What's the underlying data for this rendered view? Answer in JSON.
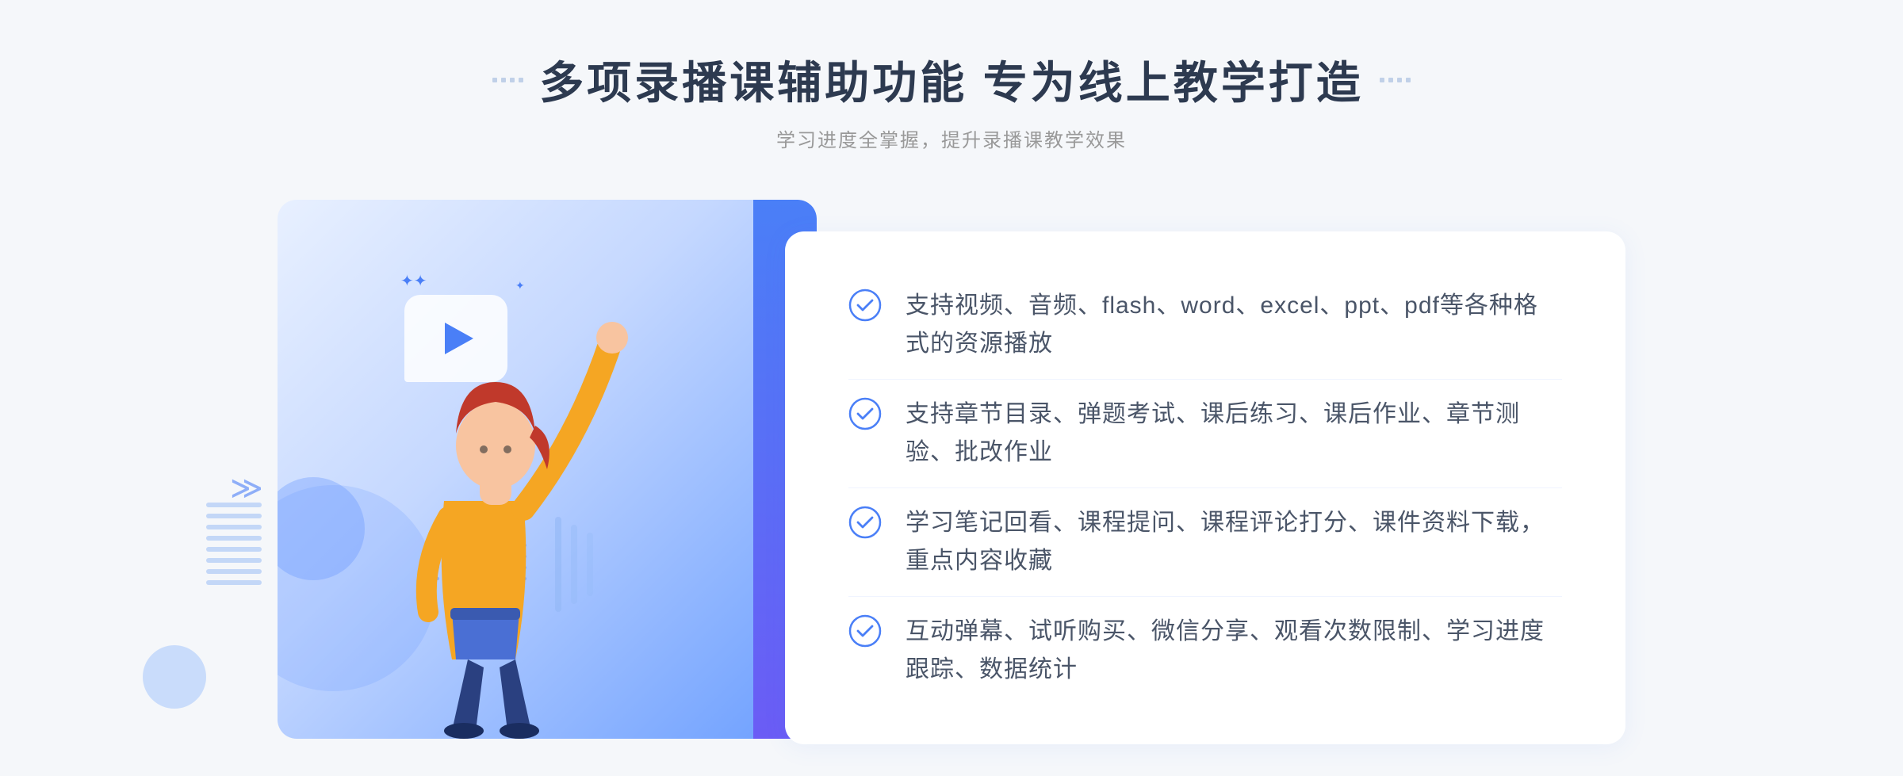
{
  "header": {
    "title": "多项录播课辅助功能 专为线上教学打造",
    "subtitle": "学习进度全掌握，提升录播课教学效果",
    "title_deco_left": "decorative dots",
    "title_deco_right": "decorative dots"
  },
  "features": [
    {
      "id": 1,
      "text": "支持视频、音频、flash、word、excel、ppt、pdf等各种格式的资源播放"
    },
    {
      "id": 2,
      "text": "支持章节目录、弹题考试、课后练习、课后作业、章节测验、批改作业"
    },
    {
      "id": 3,
      "text": "学习笔记回看、课程提问、课程评论打分、课件资料下载，重点内容收藏"
    },
    {
      "id": 4,
      "text": "互动弹幕、试听购买、微信分享、观看次数限制、学习进度跟踪、数据统计"
    }
  ],
  "colors": {
    "primary": "#4a7ff7",
    "title": "#2d3a50",
    "subtitle": "#999999",
    "feature_text": "#4a5568",
    "check": "#4a7ff7",
    "bg": "#f5f7fa"
  },
  "icons": {
    "play": "play-icon",
    "check": "check-circle-icon",
    "chevron": "chevron-right-icon"
  }
}
